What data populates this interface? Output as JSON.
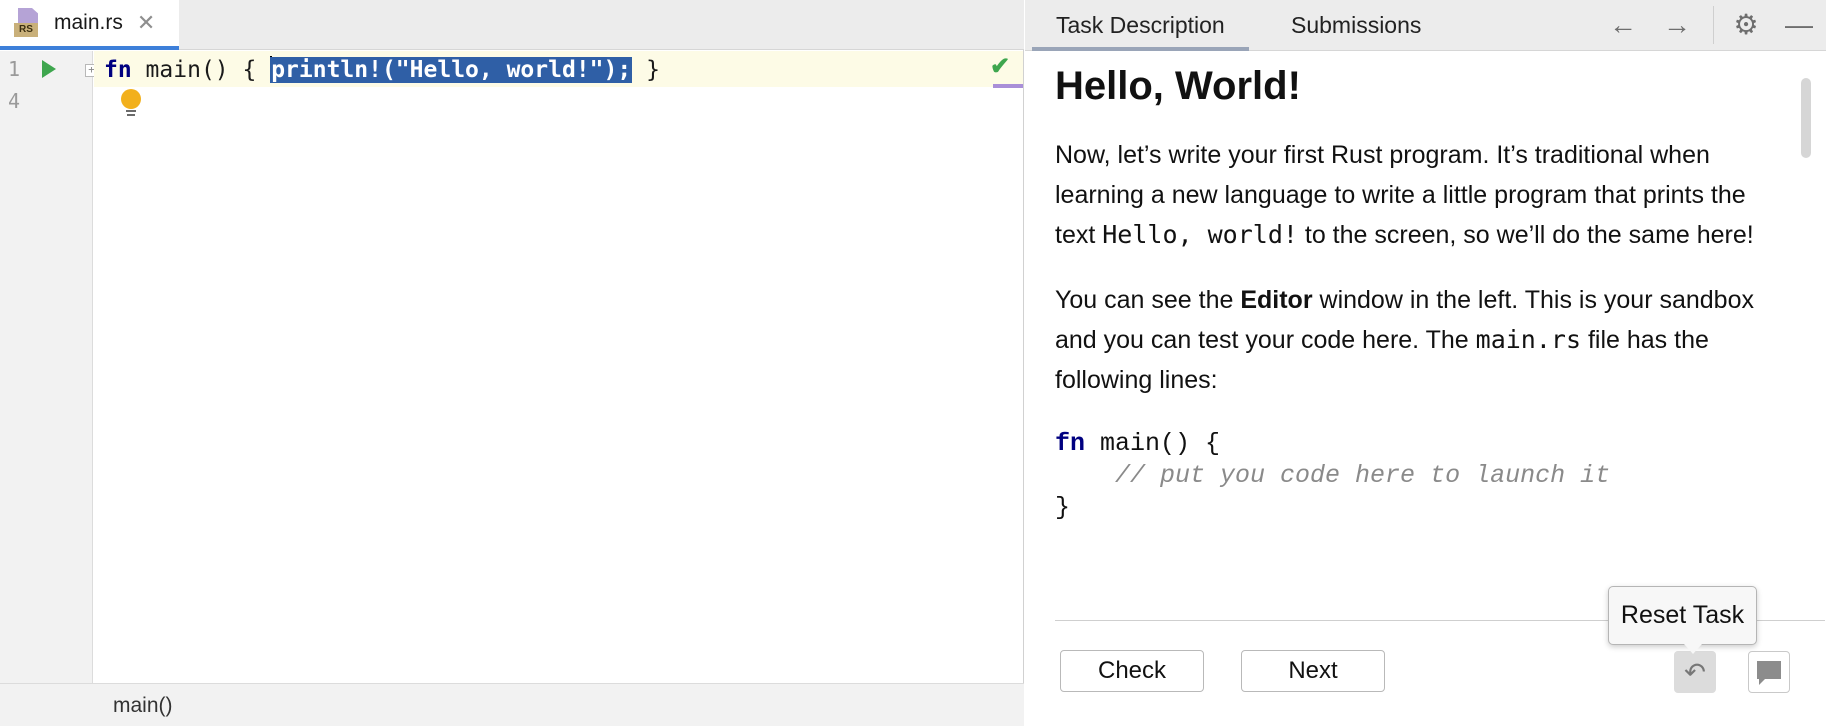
{
  "editor": {
    "tab": {
      "label": "main.rs",
      "close": "✕",
      "badge": "RS"
    },
    "line_numbers": [
      "1",
      "4"
    ],
    "code": {
      "keyword": "fn",
      "before_sel": " main() { ",
      "selected": "println!(\"Hello, world!\");",
      "after_sel": " }"
    },
    "fold_glyph": "+",
    "check_glyph": "✔",
    "breadcrumb": "main()"
  },
  "task_panel": {
    "tabs": [
      {
        "label": "Task Description",
        "active": true
      },
      {
        "label": "Submissions",
        "active": false
      }
    ],
    "header_icons": {
      "back": "←",
      "forward": "→",
      "settings": "⚙",
      "minimize": "—"
    },
    "title": "Hello, World!",
    "para1": {
      "text_a": "Now, let’s write your first Rust program. It’s traditional when learning a new language to write a little program that prints the text ",
      "code": "Hello, world!",
      "text_b": " to the screen, so we’ll do the same here!"
    },
    "para2": {
      "text_a": "You can see the ",
      "bold": "Editor",
      "text_b": " window in the left. This is your sandbox and you can test your code here. The ",
      "code": "main.rs",
      "text_c": " file has the following lines:"
    },
    "code_block": {
      "kw": "fn",
      "line1_rest": " main() {",
      "line2_indent": "    ",
      "line2_comment": "// put you code here to launch it",
      "line3": "}"
    },
    "buttons": {
      "check": "Check",
      "next": "Next"
    },
    "reset_glyph": "↶",
    "tooltip": "Reset Task"
  },
  "colors": {
    "keyword": "#000080",
    "selection": "#2f5fa6",
    "run": "#3ea64e",
    "tab_underline": "#3d7fd9"
  }
}
